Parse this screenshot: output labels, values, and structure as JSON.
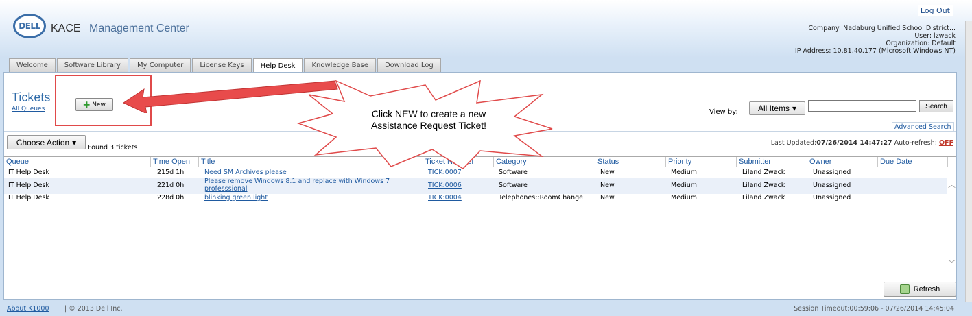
{
  "header": {
    "logo_text": "DELL",
    "brand": "KACE",
    "product": "Management Center",
    "logout": "Log Out",
    "company": "Company: Nadaburg Unified School District...",
    "user": "User: lzwack",
    "organization": "Organization: Default",
    "ip": "IP Address: 10.81.40.177 (Microsoft Windows NT)"
  },
  "tabs": [
    {
      "label": "Welcome"
    },
    {
      "label": "Software Library"
    },
    {
      "label": "My Computer"
    },
    {
      "label": "License Keys"
    },
    {
      "label": "Help Desk"
    },
    {
      "label": "Knowledge Base"
    },
    {
      "label": "Download Log"
    }
  ],
  "main": {
    "title": "Tickets",
    "all_queues": "All Queues",
    "new_label": "New",
    "view_by": "View by:",
    "all_items": "All Items",
    "search_label": "Search",
    "advanced_search": "Advanced Search",
    "choose_action": "Choose Action",
    "found": "Found 3 tickets",
    "last_updated_label": "Last Updated:",
    "last_updated_value": "07/26/2014 14:47:27",
    "auto_refresh_label": "Auto-refresh:",
    "auto_refresh_value": "OFF",
    "refresh_label": "Refresh"
  },
  "columns": [
    "Queue",
    "Time Open",
    "Title",
    "Ticket Number",
    "Category",
    "Status",
    "Priority",
    "Submitter",
    "Owner",
    "Due Date"
  ],
  "rows": [
    {
      "queue": "IT Help Desk",
      "time_open": "215d 1h",
      "title1": "Need SM Archives please",
      "title2": "",
      "ticket": "TICK:0007",
      "category": "Software",
      "status": "New",
      "priority": "Medium",
      "submitter": "Liland Zwack",
      "owner": "Unassigned",
      "due": ""
    },
    {
      "queue": "IT Help Desk",
      "time_open": "221d 0h",
      "title1": "Please remove Windows 8.1 and replace with Windows 7",
      "title2": "professsional",
      "ticket": "TICK:0006",
      "category": "Software",
      "status": "New",
      "priority": "Medium",
      "submitter": "Liland Zwack",
      "owner": "Unassigned",
      "due": ""
    },
    {
      "queue": "IT Help Desk",
      "time_open": "228d 0h",
      "title1": "blinking green light",
      "title2": "",
      "ticket": "TICK:0004",
      "category": "Telephones::RoomChange",
      "status": "New",
      "priority": "Medium",
      "submitter": "Liland Zwack",
      "owner": "Unassigned",
      "due": ""
    }
  ],
  "callout": {
    "line1": "Click NEW to create a new",
    "line2": "Assistance Request Ticket!"
  },
  "footer": {
    "about": "About K1000",
    "copyright": "|  © 2013 Dell Inc.",
    "session": "Session Timeout:00:59:06 - 07/26/2014 14:45:04"
  },
  "colors": {
    "accent": "#1f5aa0",
    "title": "#2e6aa8",
    "annotation": "#e04a4a",
    "alt_row": "#eaf0f9"
  }
}
